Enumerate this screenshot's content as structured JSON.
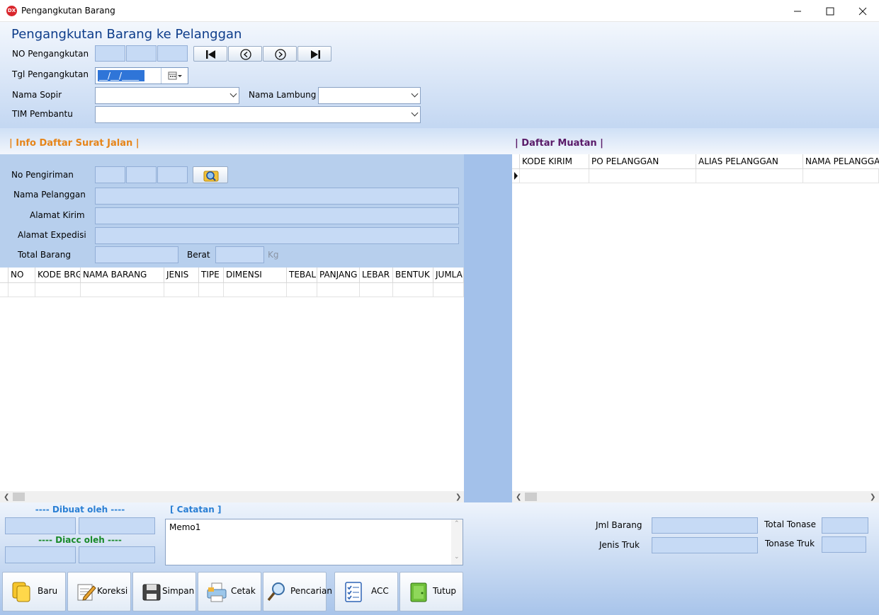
{
  "window": {
    "title": "Pengangkutan Barang",
    "app_icon_text": "DX"
  },
  "header": {
    "title": "Pengangkutan Barang ke Pelanggan",
    "no_pengangkutan_label": "NO Pengangkutan",
    "tgl_pengangkutan_label": "Tgl Pengangkutan",
    "tgl_value": "__/__/____",
    "nama_sopir_label": "Nama Sopir",
    "nama_lambung_label": "Nama Lambung",
    "tim_pembantu_label": "TIM Pembantu"
  },
  "info_surat_jalan": {
    "title": "| Info Daftar Surat Jalan |",
    "no_pengiriman_label": "No Pengiriman",
    "nama_pelanggan_label": "Nama Pelanggan",
    "alamat_kirim_label": "Alamat Kirim",
    "alamat_expedisi_label": "Alamat Expedisi",
    "total_barang_label": "Total Barang",
    "berat_label": "Berat",
    "berat_unit": "Kg"
  },
  "barang_grid": {
    "columns": [
      "NO",
      "KODE BRG",
      "NAMA BARANG",
      "JENIS",
      "TIPE",
      "DIMENSI",
      "TEBAL",
      "PANJANG",
      "LEBAR",
      "BENTUK",
      "JUMLAH"
    ]
  },
  "daftar_muatan": {
    "title": "| Daftar Muatan |",
    "columns": [
      "KODE KIRIM",
      "PO PELANGGAN",
      "ALIAS PELANGGAN",
      "NAMA PELANGGAN"
    ]
  },
  "footer": {
    "dibuat_oleh_label": "---- Dibuat oleh ----",
    "diacc_oleh_label": "---- Diacc oleh ----",
    "catatan_label": "[ Catatan ]",
    "memo_value": "Memo1",
    "jml_barang_label": "Jml Barang",
    "jenis_truk_label": "Jenis Truk",
    "total_tonase_label": "Total Tonase",
    "tonase_truk_label": "Tonase Truk"
  },
  "toolbar": {
    "baru": "Baru",
    "koreksi": "Koreksi",
    "simpan": "Simpan",
    "cetak": "Cetak",
    "pencarian": "Pencarian",
    "acc": "ACC",
    "tutup": "Tutup"
  },
  "colors": {
    "accent_orange": "#e6851a",
    "accent_purple": "#5a1a68",
    "dibuat_blue": "#2a7fd4",
    "diacc_green": "#1a8a2a",
    "panel_blue": "#b7cfed"
  }
}
